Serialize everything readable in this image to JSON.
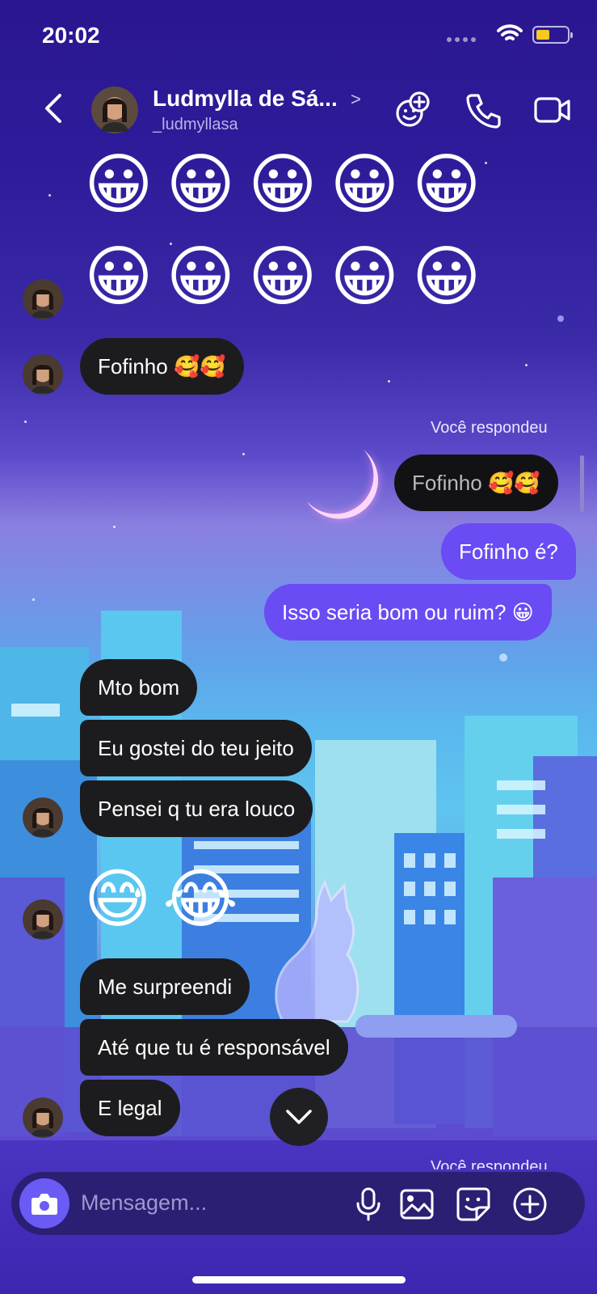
{
  "status_bar": {
    "time": "20:02"
  },
  "header": {
    "name": "Ludmylla de Sá...",
    "username": "_ludmyllasa"
  },
  "messages": {
    "fofinho_in": "Fofinho 🥰🥰",
    "reply_label": "Você respondeu",
    "quoted": "Fofinho 🥰🥰",
    "out_1": "Fofinho é?",
    "out_2": "Isso seria bom ou ruim? 😀",
    "in_1": "Mto bom",
    "in_2": "Eu gostei do teu jeito",
    "in_3": "Pensei q tu era louco",
    "emoji_pair": "😅😂",
    "in_4": "Me surpreendi",
    "in_5": "Até que tu é responsável",
    "in_6": "E legal",
    "reply_label_2": "Você respondeu"
  },
  "big_emoji_row": "😀😀😀😀😀",
  "composer": {
    "placeholder": "Mensagem..."
  }
}
